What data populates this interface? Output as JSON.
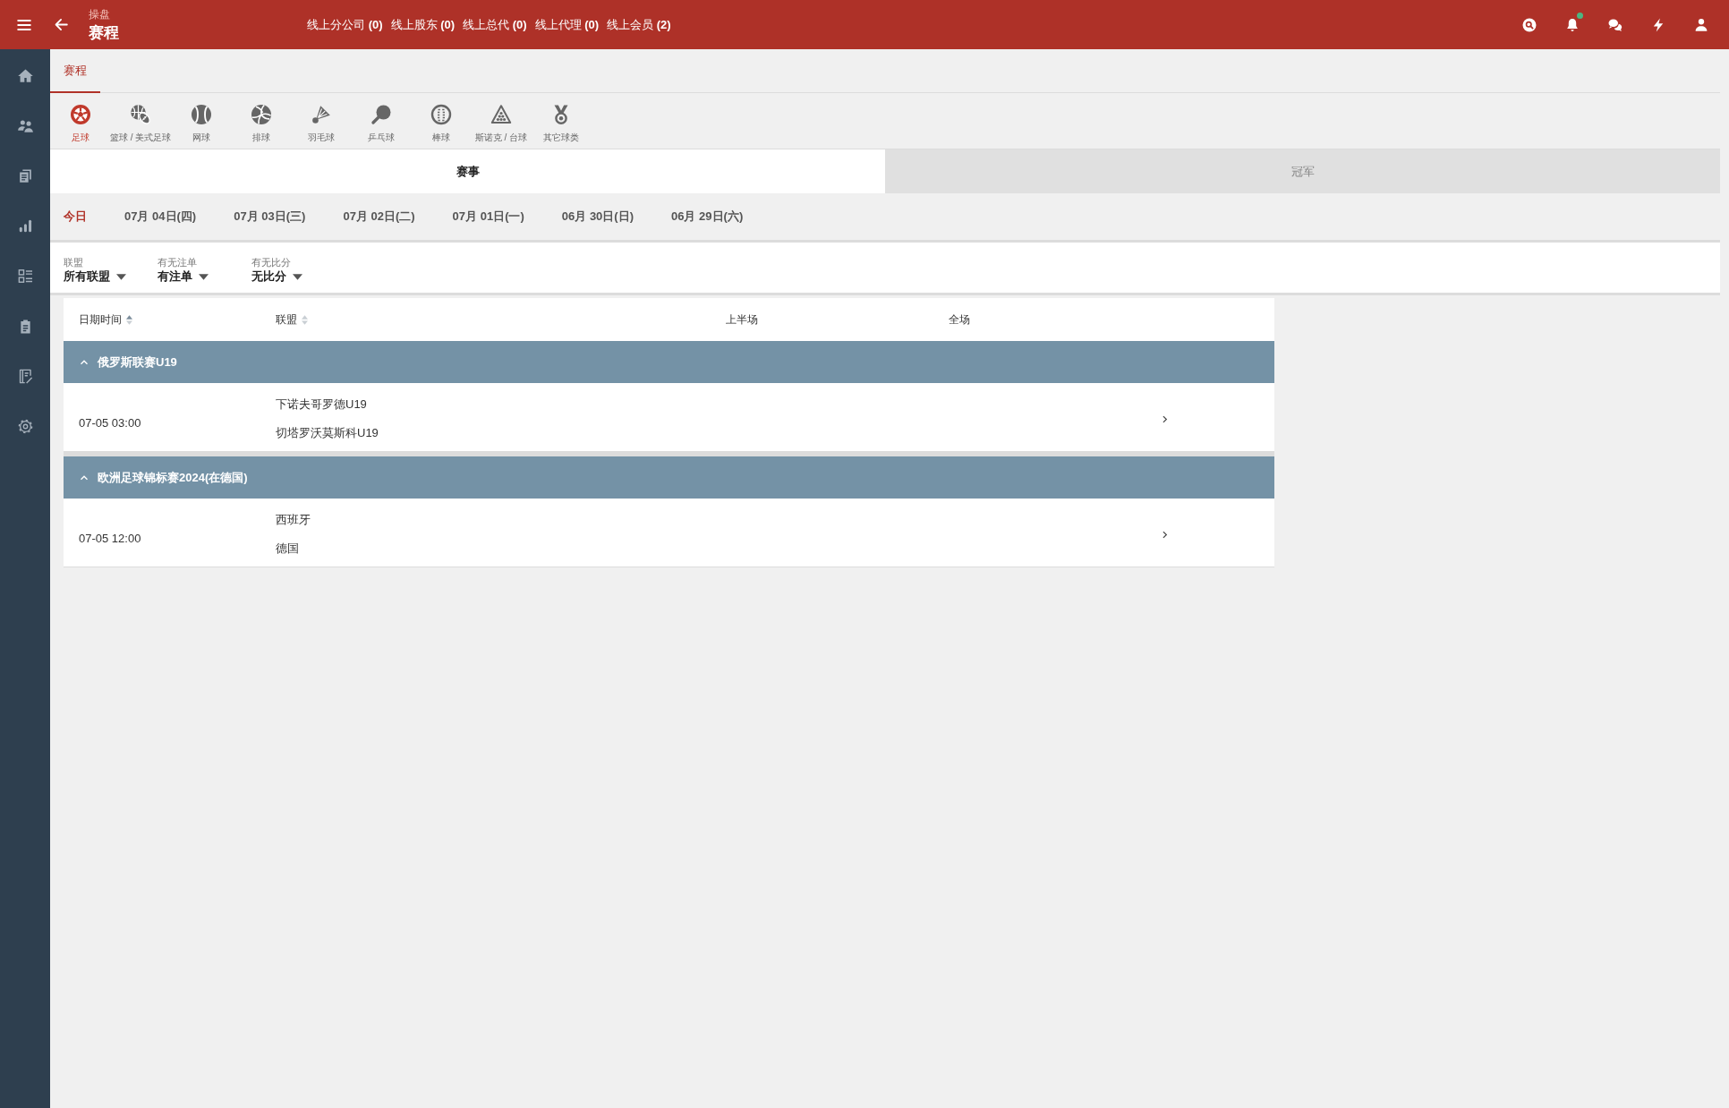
{
  "header": {
    "subtitle": "操盘",
    "title": "赛程",
    "links": [
      "线上分公司 **(0)**",
      "线上股东 **(0)**",
      "线上总代 **(0)**",
      "线上代理 **(0)**",
      "线上会员 **(2)**"
    ],
    "notification_unread": true
  },
  "page_tabs": [
    {
      "label": "赛程",
      "selected": true
    }
  ],
  "sports": [
    {
      "label": "足球",
      "selected": true
    },
    {
      "label": "篮球 / 美式足球",
      "selected": false
    },
    {
      "label": "网球",
      "selected": false
    },
    {
      "label": "排球",
      "selected": false
    },
    {
      "label": "羽毛球",
      "selected": false
    },
    {
      "label": "乒乓球",
      "selected": false
    },
    {
      "label": "棒球",
      "selected": false
    },
    {
      "label": "斯诺克 / 台球",
      "selected": false
    },
    {
      "label": "其它球类",
      "selected": false
    }
  ],
  "views": [
    {
      "label": "赛事",
      "selected": true
    },
    {
      "label": "冠军",
      "selected": false
    }
  ],
  "dates": [
    {
      "label": "今日",
      "selected": true
    },
    {
      "label": "07月 04日(四)",
      "selected": false
    },
    {
      "label": "07月 03日(三)",
      "selected": false
    },
    {
      "label": "07月 02日(二)",
      "selected": false
    },
    {
      "label": "07月 01日(一)",
      "selected": false
    },
    {
      "label": "06月 30日(日)",
      "selected": false
    },
    {
      "label": "06月 29日(六)",
      "selected": false
    }
  ],
  "filters": [
    {
      "label": "联盟",
      "value": "所有联盟"
    },
    {
      "label": "有无注单",
      "value": "有注单"
    },
    {
      "label": "有无比分",
      "value": "无比分"
    }
  ],
  "table": {
    "columns": [
      {
        "label": "日期时间",
        "sortable": true,
        "sorted": true
      },
      {
        "label": "联盟",
        "sortable": true,
        "sorted": false
      },
      {
        "label": "上半场",
        "sortable": false
      },
      {
        "label": "全场",
        "sortable": false
      }
    ],
    "groups": [
      {
        "league": "俄罗斯联赛U19",
        "expanded": true,
        "matches": [
          {
            "time": "07-05 03:00",
            "home": "下诺夫哥罗德U19",
            "away": "切塔罗沃莫斯科U19"
          }
        ]
      },
      {
        "league": "欧洲足球锦标赛2024(在德国)",
        "expanded": true,
        "matches": [
          {
            "time": "07-05 12:00",
            "home": "西班牙",
            "away": "德国"
          }
        ]
      }
    ]
  }
}
